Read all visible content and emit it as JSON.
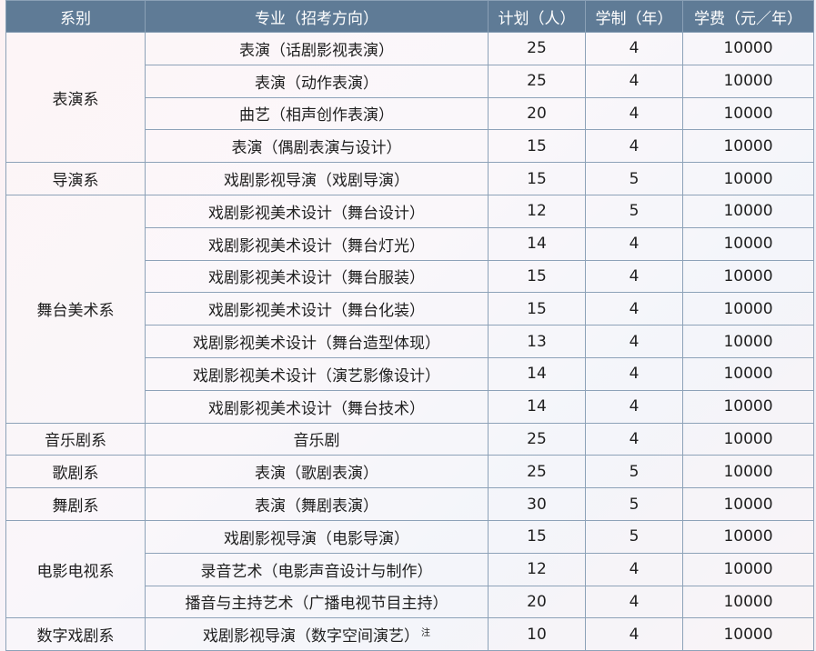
{
  "headers": [
    "系别",
    "专业（招考方向）",
    "计划（人）",
    "学制（年）",
    "学费（元／年）"
  ],
  "departments": [
    {
      "name": "表演系",
      "rows": [
        {
          "major": "表演（话剧影视表演）",
          "plan": "25",
          "years": "4",
          "fee": "10000"
        },
        {
          "major": "表演（动作表演）",
          "plan": "25",
          "years": "4",
          "fee": "10000"
        },
        {
          "major": "曲艺（相声创作表演）",
          "plan": "20",
          "years": "4",
          "fee": "10000"
        },
        {
          "major": "表演（偶剧表演与设计）",
          "plan": "15",
          "years": "4",
          "fee": "10000"
        }
      ]
    },
    {
      "name": "导演系",
      "rows": [
        {
          "major": "戏剧影视导演（戏剧导演）",
          "plan": "15",
          "years": "5",
          "fee": "10000"
        }
      ]
    },
    {
      "name": "舞台美术系",
      "rows": [
        {
          "major": "戏剧影视美术设计（舞台设计）",
          "plan": "12",
          "years": "5",
          "fee": "10000"
        },
        {
          "major": "戏剧影视美术设计（舞台灯光）",
          "plan": "14",
          "years": "4",
          "fee": "10000"
        },
        {
          "major": "戏剧影视美术设计（舞台服装）",
          "plan": "15",
          "years": "4",
          "fee": "10000"
        },
        {
          "major": "戏剧影视美术设计（舞台化装）",
          "plan": "15",
          "years": "4",
          "fee": "10000"
        },
        {
          "major": "戏剧影视美术设计（舞台造型体现）",
          "plan": "13",
          "years": "4",
          "fee": "10000"
        },
        {
          "major": "戏剧影视美术设计（演艺影像设计）",
          "plan": "14",
          "years": "4",
          "fee": "10000"
        },
        {
          "major": "戏剧影视美术设计（舞台技术）",
          "plan": "14",
          "years": "4",
          "fee": "10000"
        }
      ]
    },
    {
      "name": "音乐剧系",
      "rows": [
        {
          "major": "音乐剧",
          "plan": "25",
          "years": "4",
          "fee": "10000"
        }
      ]
    },
    {
      "name": "歌剧系",
      "rows": [
        {
          "major": "表演（歌剧表演）",
          "plan": "25",
          "years": "5",
          "fee": "10000"
        }
      ]
    },
    {
      "name": "舞剧系",
      "rows": [
        {
          "major": "表演（舞剧表演）",
          "plan": "30",
          "years": "5",
          "fee": "10000"
        }
      ]
    },
    {
      "name": "电影电视系",
      "rows": [
        {
          "major": "戏剧影视导演（电影导演）",
          "plan": "15",
          "years": "5",
          "fee": "10000"
        },
        {
          "major": "录音艺术（电影声音设计与制作）",
          "plan": "12",
          "years": "4",
          "fee": "10000"
        },
        {
          "major": "播音与主持艺术（广播电视节目主持）",
          "plan": "20",
          "years": "4",
          "fee": "10000"
        }
      ]
    },
    {
      "name": "数字戏剧系",
      "rows": [
        {
          "major": "戏剧影视导演（数字空间演艺）",
          "note": "注",
          "plan": "10",
          "years": "4",
          "fee": "10000"
        }
      ]
    }
  ]
}
